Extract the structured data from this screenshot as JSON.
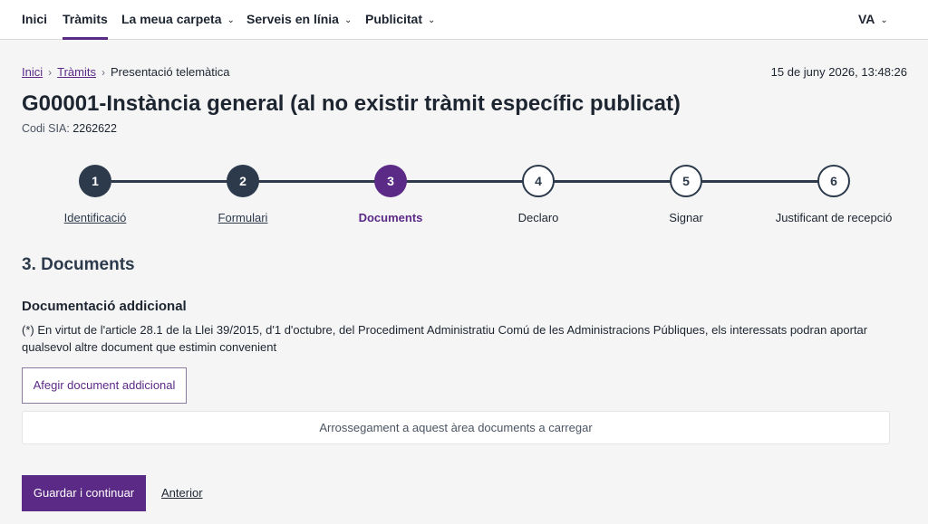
{
  "nav": {
    "items": [
      {
        "label": "Inici",
        "has_dropdown": false,
        "active": false
      },
      {
        "label": "Tràmits",
        "has_dropdown": false,
        "active": true
      },
      {
        "label": "La meua carpeta",
        "has_dropdown": true,
        "active": false
      },
      {
        "label": "Serveis en línia",
        "has_dropdown": true,
        "active": false
      },
      {
        "label": "Publicitat",
        "has_dropdown": true,
        "active": false
      }
    ],
    "language": {
      "label": "VA",
      "has_dropdown": true
    },
    "chevron_icon": "chevron-down-icon",
    "accent_color": "#5b2a86"
  },
  "breadcrumb": {
    "items": [
      "Inici",
      "Tràmits",
      "Presentació telemàtica"
    ],
    "separator_icon": "chevron-right-icon"
  },
  "datetime": "15 de juny 2026, 13:48:26",
  "title": "G00001-Instància general (al no existir tràmit específic publicat)",
  "sia": {
    "label": "Codi SIA:",
    "value": "2262622"
  },
  "stepper": {
    "steps": [
      {
        "number": "1",
        "label": "Identificació",
        "state": "done"
      },
      {
        "number": "2",
        "label": "Formulari",
        "state": "done"
      },
      {
        "number": "3",
        "label": "Documents",
        "state": "current"
      },
      {
        "number": "4",
        "label": "Declaro",
        "state": "pending"
      },
      {
        "number": "5",
        "label": "Signar",
        "state": "pending"
      },
      {
        "number": "6",
        "label": "Justificant de recepció",
        "state": "pending"
      }
    ],
    "colors": {
      "done": "#2c3a4b",
      "current": "#5b2a86",
      "pending_border": "#2c3a4b"
    }
  },
  "section": {
    "title": "3. Documents",
    "subtitle": "Documentació addicional",
    "legal_text": "(*) En virtut de l'article 28.1 de la Llei 39/2015, d'1 d'octubre, del Procediment Administratiu Comú de les Administracions Públiques, els interessats podran aportar qualsevol altre document que estimin convenient",
    "add_button": "Afegir document addicional",
    "dropzone_text": "Arrossegament a aquest àrea documents a carregar"
  },
  "actions": {
    "primary": "Guardar i continuar",
    "back": "Anterior"
  }
}
